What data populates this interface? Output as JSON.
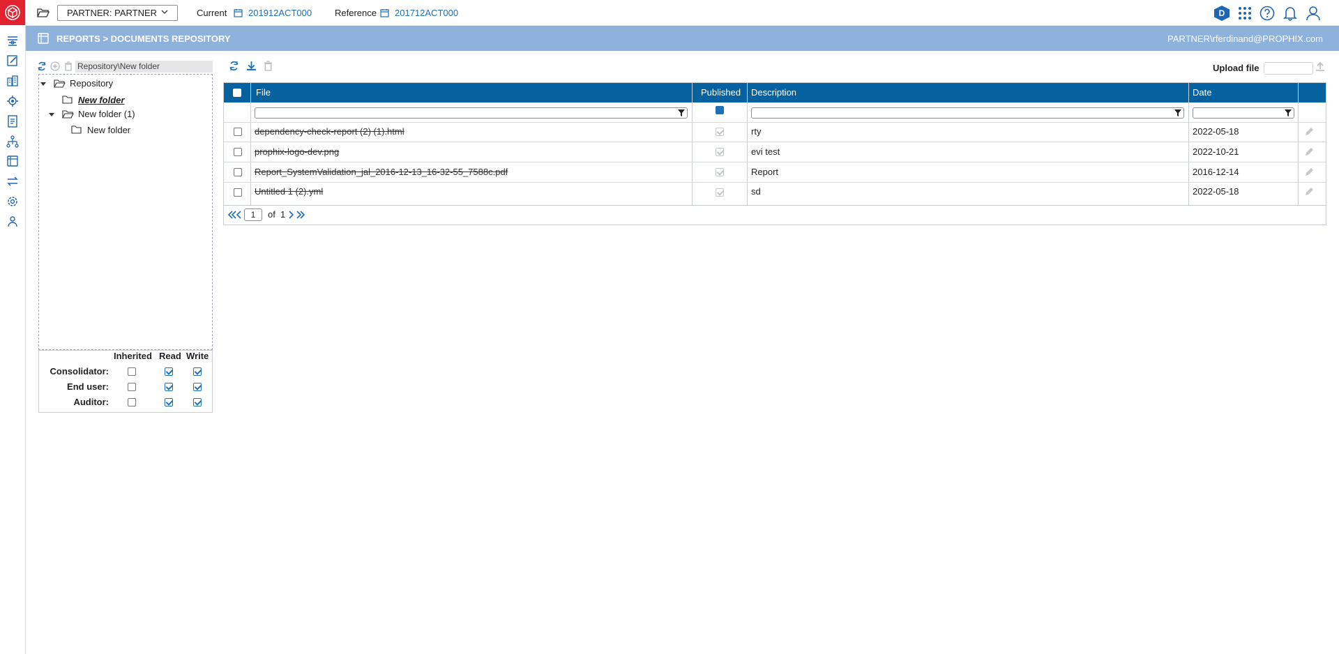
{
  "topbar": {
    "partner_select": "PARTNER: PARTNER",
    "current_label": "Current",
    "current_value": "201912ACT000",
    "reference_label": "Reference",
    "reference_value": "201712ACT000",
    "badge_letter": "D"
  },
  "titleband": {
    "breadcrumb": "REPORTS > DOCUMENTS REPOSITORY",
    "user": "PARTNER\\rferdinand@PROPHIX.com"
  },
  "tree": {
    "path": "Repository\\New folder",
    "nodes": [
      {
        "label": "Repository"
      },
      {
        "label": "New folder"
      },
      {
        "label": "New folder (1)"
      },
      {
        "label": "New folder"
      }
    ]
  },
  "permissions": {
    "columns": [
      "Inherited",
      "Read",
      "Write"
    ],
    "rows": [
      {
        "label": "Consolidator:",
        "inherited": false,
        "read": true,
        "write": true
      },
      {
        "label": "End user:",
        "inherited": false,
        "read": true,
        "write": true
      },
      {
        "label": "Auditor:",
        "inherited": false,
        "read": true,
        "write": true
      }
    ]
  },
  "grid": {
    "upload_label": "Upload file",
    "columns": [
      "File",
      "Published",
      "Description",
      "Date"
    ],
    "rows": [
      {
        "file": "dependency-check-report (2) (1).html",
        "published": true,
        "description": "rty",
        "date": "2022-05-18"
      },
      {
        "file": "prophix-logo-dev.png",
        "published": true,
        "description": "evi test",
        "date": "2022-10-21"
      },
      {
        "file": "Report_SystemValidation_jal_2016-12-13_16-32-55_7588c.pdf",
        "published": true,
        "description": "Report",
        "date": "2016-12-14"
      },
      {
        "file": "Untitled 1 (2).yml",
        "published": true,
        "description": "sd",
        "date": "2022-05-18"
      }
    ],
    "pager": {
      "page": "1",
      "of_label": "of",
      "total": "1"
    }
  },
  "colors": {
    "brand_red": "#e2232f",
    "header_blue": "#05629f",
    "title_band": "#8fb2dd",
    "link_blue": "#1d6fb8"
  },
  "icons": {
    "rail": [
      "dashboard-icon",
      "edit-icon",
      "building-icon",
      "gear-network-icon",
      "report-icon",
      "hierarchy-icon",
      "book-icon",
      "transfer-icon",
      "settings-icon",
      "users-icon"
    ]
  }
}
